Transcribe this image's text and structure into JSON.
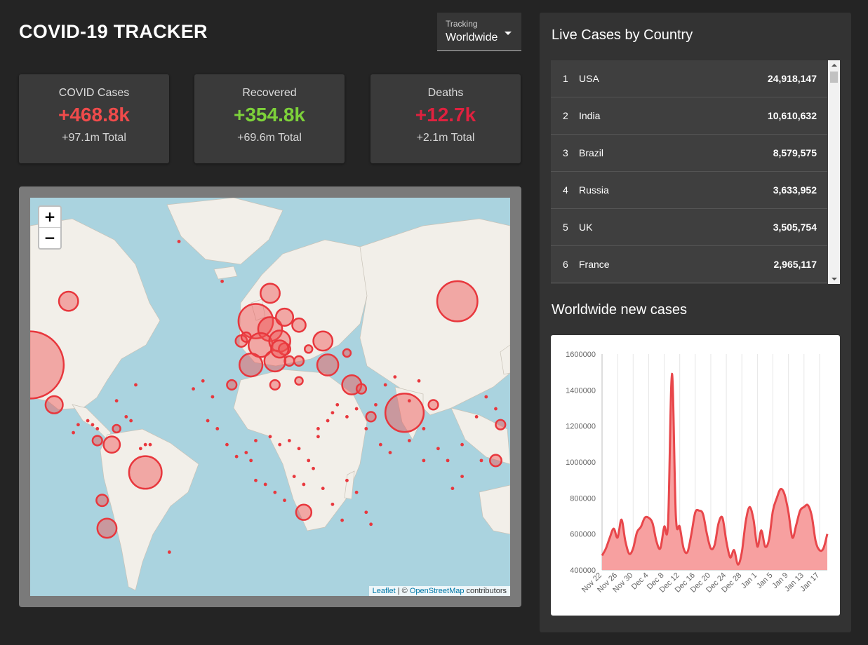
{
  "app": {
    "title": "COVID-19 TRACKER"
  },
  "tracking": {
    "label": "Tracking",
    "value": "Worldwide"
  },
  "stats": [
    {
      "title": "COVID Cases",
      "value": "+468.8k",
      "total": "+97.1m Total",
      "color": "#f04b4b"
    },
    {
      "title": "Recovered",
      "value": "+354.8k",
      "total": "+69.6m Total",
      "color": "#7dd13a"
    },
    {
      "title": "Deaths",
      "value": "+12.7k",
      "total": "+2.1m Total",
      "color": "#e0213f"
    }
  ],
  "map": {
    "zoom_in": "+",
    "zoom_out": "−",
    "attribution": {
      "leaflet": "Leaflet",
      "sep": " | © ",
      "osm": "OpenStreetMap",
      "suffix": " contributors"
    }
  },
  "live_cases": {
    "title": "Live Cases by Country",
    "rows": [
      {
        "rank": "1",
        "country": "USA",
        "cases": "24,918,147"
      },
      {
        "rank": "2",
        "country": "India",
        "cases": "10,610,632"
      },
      {
        "rank": "3",
        "country": "Brazil",
        "cases": "8,579,575"
      },
      {
        "rank": "4",
        "country": "Russia",
        "cases": "3,633,952"
      },
      {
        "rank": "5",
        "country": "UK",
        "cases": "3,505,754"
      },
      {
        "rank": "6",
        "country": "France",
        "cases": "2,965,117"
      }
    ]
  },
  "new_cases": {
    "title": "Worldwide new cases"
  },
  "chart_data": {
    "type": "area",
    "x": [
      "Nov 22",
      "Nov 23",
      "Nov 24",
      "Nov 25",
      "Nov 26",
      "Nov 27",
      "Nov 28",
      "Nov 29",
      "Nov 30",
      "Dec 1",
      "Dec 2",
      "Dec 3",
      "Dec 4",
      "Dec 5",
      "Dec 6",
      "Dec 7",
      "Dec 8",
      "Dec 9",
      "Dec 10",
      "Dec 11",
      "Dec 12",
      "Dec 13",
      "Dec 14",
      "Dec 15",
      "Dec 16",
      "Dec 17",
      "Dec 18",
      "Dec 19",
      "Dec 20",
      "Dec 21",
      "Dec 22",
      "Dec 23",
      "Dec 24",
      "Dec 25",
      "Dec 26",
      "Dec 27",
      "Dec 28",
      "Dec 29",
      "Dec 30",
      "Dec 31",
      "Jan 1",
      "Jan 2",
      "Jan 3",
      "Jan 4",
      "Jan 5",
      "Jan 6",
      "Jan 7",
      "Jan 8",
      "Jan 9",
      "Jan 10",
      "Jan 11",
      "Jan 12",
      "Jan 13",
      "Jan 14",
      "Jan 15",
      "Jan 16",
      "Jan 17",
      "Jan 18",
      "Jan 19"
    ],
    "values": [
      480000,
      520000,
      580000,
      630000,
      580000,
      680000,
      560000,
      490000,
      520000,
      610000,
      640000,
      690000,
      690000,
      660000,
      560000,
      520000,
      640000,
      660000,
      1490000,
      700000,
      640000,
      520000,
      500000,
      600000,
      720000,
      730000,
      710000,
      600000,
      520000,
      540000,
      660000,
      690000,
      560000,
      470000,
      510000,
      430000,
      500000,
      670000,
      750000,
      680000,
      530000,
      620000,
      530000,
      570000,
      730000,
      800000,
      850000,
      820000,
      720000,
      580000,
      650000,
      730000,
      750000,
      760000,
      700000,
      560000,
      510000,
      520000,
      600000
    ],
    "x_ticks": [
      "Nov 22",
      "Nov 26",
      "Nov 30",
      "Dec 4",
      "Dec 8",
      "Dec 12",
      "Dec 16",
      "Dec 20",
      "Dec 24",
      "Dec 28",
      "Jan 1",
      "Jan 5",
      "Jan 9",
      "Jan 13",
      "Jan 17"
    ],
    "y_ticks": [
      "400000",
      "600000",
      "800000",
      "1000000",
      "1200000",
      "1400000",
      "1600000"
    ],
    "ylim": [
      400000,
      1600000
    ],
    "line_color": "#e8474b",
    "fill_color": "#f7a0a0",
    "grid": true
  },
  "map_circles": [
    [
      0.0,
      0.42,
      0.07
    ],
    [
      0.05,
      0.52,
      0.018
    ],
    [
      0.08,
      0.26,
      0.02
    ],
    [
      0.89,
      0.26,
      0.042
    ],
    [
      0.47,
      0.31,
      0.036
    ],
    [
      0.5,
      0.33,
      0.025
    ],
    [
      0.48,
      0.37,
      0.025
    ],
    [
      0.52,
      0.36,
      0.022
    ],
    [
      0.53,
      0.3,
      0.018
    ],
    [
      0.56,
      0.32,
      0.014
    ],
    [
      0.61,
      0.36,
      0.02
    ],
    [
      0.62,
      0.42,
      0.022
    ],
    [
      0.67,
      0.47,
      0.02
    ],
    [
      0.78,
      0.54,
      0.04
    ],
    [
      0.24,
      0.69,
      0.034
    ],
    [
      0.17,
      0.62,
      0.017
    ],
    [
      0.16,
      0.83,
      0.02
    ],
    [
      0.15,
      0.76,
      0.012
    ],
    [
      0.57,
      0.79,
      0.016
    ],
    [
      0.46,
      0.42,
      0.024
    ],
    [
      0.51,
      0.41,
      0.022
    ],
    [
      0.53,
      0.38,
      0.012
    ],
    [
      0.58,
      0.38,
      0.008
    ],
    [
      0.56,
      0.41,
      0.01
    ],
    [
      0.44,
      0.36,
      0.012
    ],
    [
      0.5,
      0.24,
      0.02
    ],
    [
      0.52,
      0.38,
      0.018
    ],
    [
      0.54,
      0.41,
      0.01
    ],
    [
      0.45,
      0.35,
      0.01
    ],
    [
      0.66,
      0.39,
      0.008
    ],
    [
      0.42,
      0.47,
      0.01
    ],
    [
      0.51,
      0.47,
      0.01
    ],
    [
      0.56,
      0.46,
      0.008
    ],
    [
      0.69,
      0.48,
      0.01
    ],
    [
      0.71,
      0.55,
      0.01
    ],
    [
      0.84,
      0.52,
      0.01
    ],
    [
      0.98,
      0.57,
      0.01
    ],
    [
      0.97,
      0.66,
      0.012
    ],
    [
      0.14,
      0.61,
      0.01
    ],
    [
      0.18,
      0.58,
      0.008
    ]
  ],
  "map_dots": [
    [
      0.31,
      0.11
    ],
    [
      0.4,
      0.21
    ],
    [
      0.22,
      0.47
    ],
    [
      0.18,
      0.51
    ],
    [
      0.25,
      0.62
    ],
    [
      0.12,
      0.56
    ],
    [
      0.13,
      0.57
    ],
    [
      0.1,
      0.57
    ],
    [
      0.09,
      0.59
    ],
    [
      0.14,
      0.58
    ],
    [
      0.2,
      0.55
    ],
    [
      0.21,
      0.56
    ],
    [
      0.23,
      0.63
    ],
    [
      0.24,
      0.62
    ],
    [
      0.37,
      0.56
    ],
    [
      0.39,
      0.58
    ],
    [
      0.41,
      0.62
    ],
    [
      0.43,
      0.65
    ],
    [
      0.45,
      0.64
    ],
    [
      0.47,
      0.61
    ],
    [
      0.5,
      0.6
    ],
    [
      0.52,
      0.62
    ],
    [
      0.54,
      0.61
    ],
    [
      0.56,
      0.63
    ],
    [
      0.58,
      0.66
    ],
    [
      0.6,
      0.6
    ],
    [
      0.63,
      0.54
    ],
    [
      0.66,
      0.55
    ],
    [
      0.68,
      0.53
    ],
    [
      0.7,
      0.58
    ],
    [
      0.73,
      0.62
    ],
    [
      0.75,
      0.64
    ],
    [
      0.79,
      0.61
    ],
    [
      0.82,
      0.58
    ],
    [
      0.85,
      0.63
    ],
    [
      0.87,
      0.66
    ],
    [
      0.9,
      0.62
    ],
    [
      0.93,
      0.55
    ],
    [
      0.95,
      0.5
    ],
    [
      0.97,
      0.53
    ],
    [
      0.94,
      0.66
    ],
    [
      0.9,
      0.7
    ],
    [
      0.88,
      0.73
    ],
    [
      0.82,
      0.66
    ],
    [
      0.46,
      0.66
    ],
    [
      0.47,
      0.71
    ],
    [
      0.49,
      0.72
    ],
    [
      0.51,
      0.74
    ],
    [
      0.53,
      0.76
    ],
    [
      0.55,
      0.7
    ],
    [
      0.57,
      0.72
    ],
    [
      0.59,
      0.68
    ],
    [
      0.61,
      0.73
    ],
    [
      0.63,
      0.77
    ],
    [
      0.65,
      0.81
    ],
    [
      0.66,
      0.71
    ],
    [
      0.68,
      0.74
    ],
    [
      0.7,
      0.79
    ],
    [
      0.71,
      0.82
    ],
    [
      0.29,
      0.89
    ],
    [
      0.6,
      0.58
    ],
    [
      0.62,
      0.56
    ],
    [
      0.64,
      0.52
    ],
    [
      0.72,
      0.52
    ],
    [
      0.74,
      0.47
    ],
    [
      0.76,
      0.45
    ],
    [
      0.79,
      0.51
    ],
    [
      0.81,
      0.46
    ],
    [
      0.36,
      0.46
    ],
    [
      0.38,
      0.5
    ],
    [
      0.34,
      0.48
    ]
  ]
}
